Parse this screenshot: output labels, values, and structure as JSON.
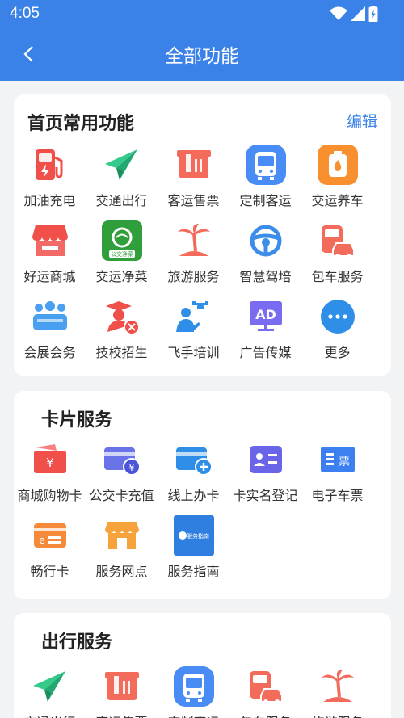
{
  "status": {
    "time": "4:05"
  },
  "header": {
    "title": "全部功能"
  },
  "home_section": {
    "title": "首页常用功能",
    "edit_label": "编辑",
    "items": [
      {
        "label": "加油充电",
        "icon": "fuel-pump-icon"
      },
      {
        "label": "交通出行",
        "icon": "paper-plane-icon"
      },
      {
        "label": "客运售票",
        "icon": "ticket-icon"
      },
      {
        "label": "定制客运",
        "icon": "bus-icon"
      },
      {
        "label": "交运养车",
        "icon": "oil-can-icon"
      },
      {
        "label": "好运商城",
        "icon": "shop-icon"
      },
      {
        "label": "交运净菜",
        "icon": "vegetable-logo-icon"
      },
      {
        "label": "旅游服务",
        "icon": "palm-island-icon"
      },
      {
        "label": "智慧驾培",
        "icon": "steering-wheel-icon"
      },
      {
        "label": "包车服务",
        "icon": "car-rental-icon"
      },
      {
        "label": "会展会务",
        "icon": "meeting-icon"
      },
      {
        "label": "技校招生",
        "icon": "graduate-tools-icon"
      },
      {
        "label": "飞手培训",
        "icon": "drone-pilot-icon"
      },
      {
        "label": "广告传媒",
        "icon": "ad-monitor-icon"
      },
      {
        "label": "更多",
        "icon": "more-dots-icon"
      }
    ],
    "logo_text": "公交净菜"
  },
  "card_section": {
    "title": "卡片服务",
    "items": [
      {
        "label": "商城购物卡",
        "icon": "yen-wallet-icon"
      },
      {
        "label": "公交卡充值",
        "icon": "card-recharge-icon"
      },
      {
        "label": "线上办卡",
        "icon": "card-add-icon"
      },
      {
        "label": "卡实名登记",
        "icon": "id-card-icon"
      },
      {
        "label": "电子车票",
        "icon": "e-ticket-icon"
      },
      {
        "label": "畅行卡",
        "icon": "e-card-icon"
      },
      {
        "label": "服务网点",
        "icon": "service-outlet-icon"
      },
      {
        "label": "服务指南",
        "icon": "service-guide-icon"
      }
    ],
    "eticket_text": "票",
    "guide_text": "服务指南"
  },
  "travel_section": {
    "title": "出行服务",
    "items": [
      {
        "label": "交通出行",
        "icon": "paper-plane-icon"
      },
      {
        "label": "客运售票",
        "icon": "ticket-icon"
      },
      {
        "label": "定制客运",
        "icon": "bus-icon"
      },
      {
        "label": "包车服务",
        "icon": "car-rental-icon"
      },
      {
        "label": "旅游服务",
        "icon": "palm-island-icon"
      }
    ]
  },
  "colors": {
    "primary": "#3b82e8",
    "red": "#f04f4a",
    "green": "#2ecc8a",
    "orange": "#f58a3a"
  }
}
